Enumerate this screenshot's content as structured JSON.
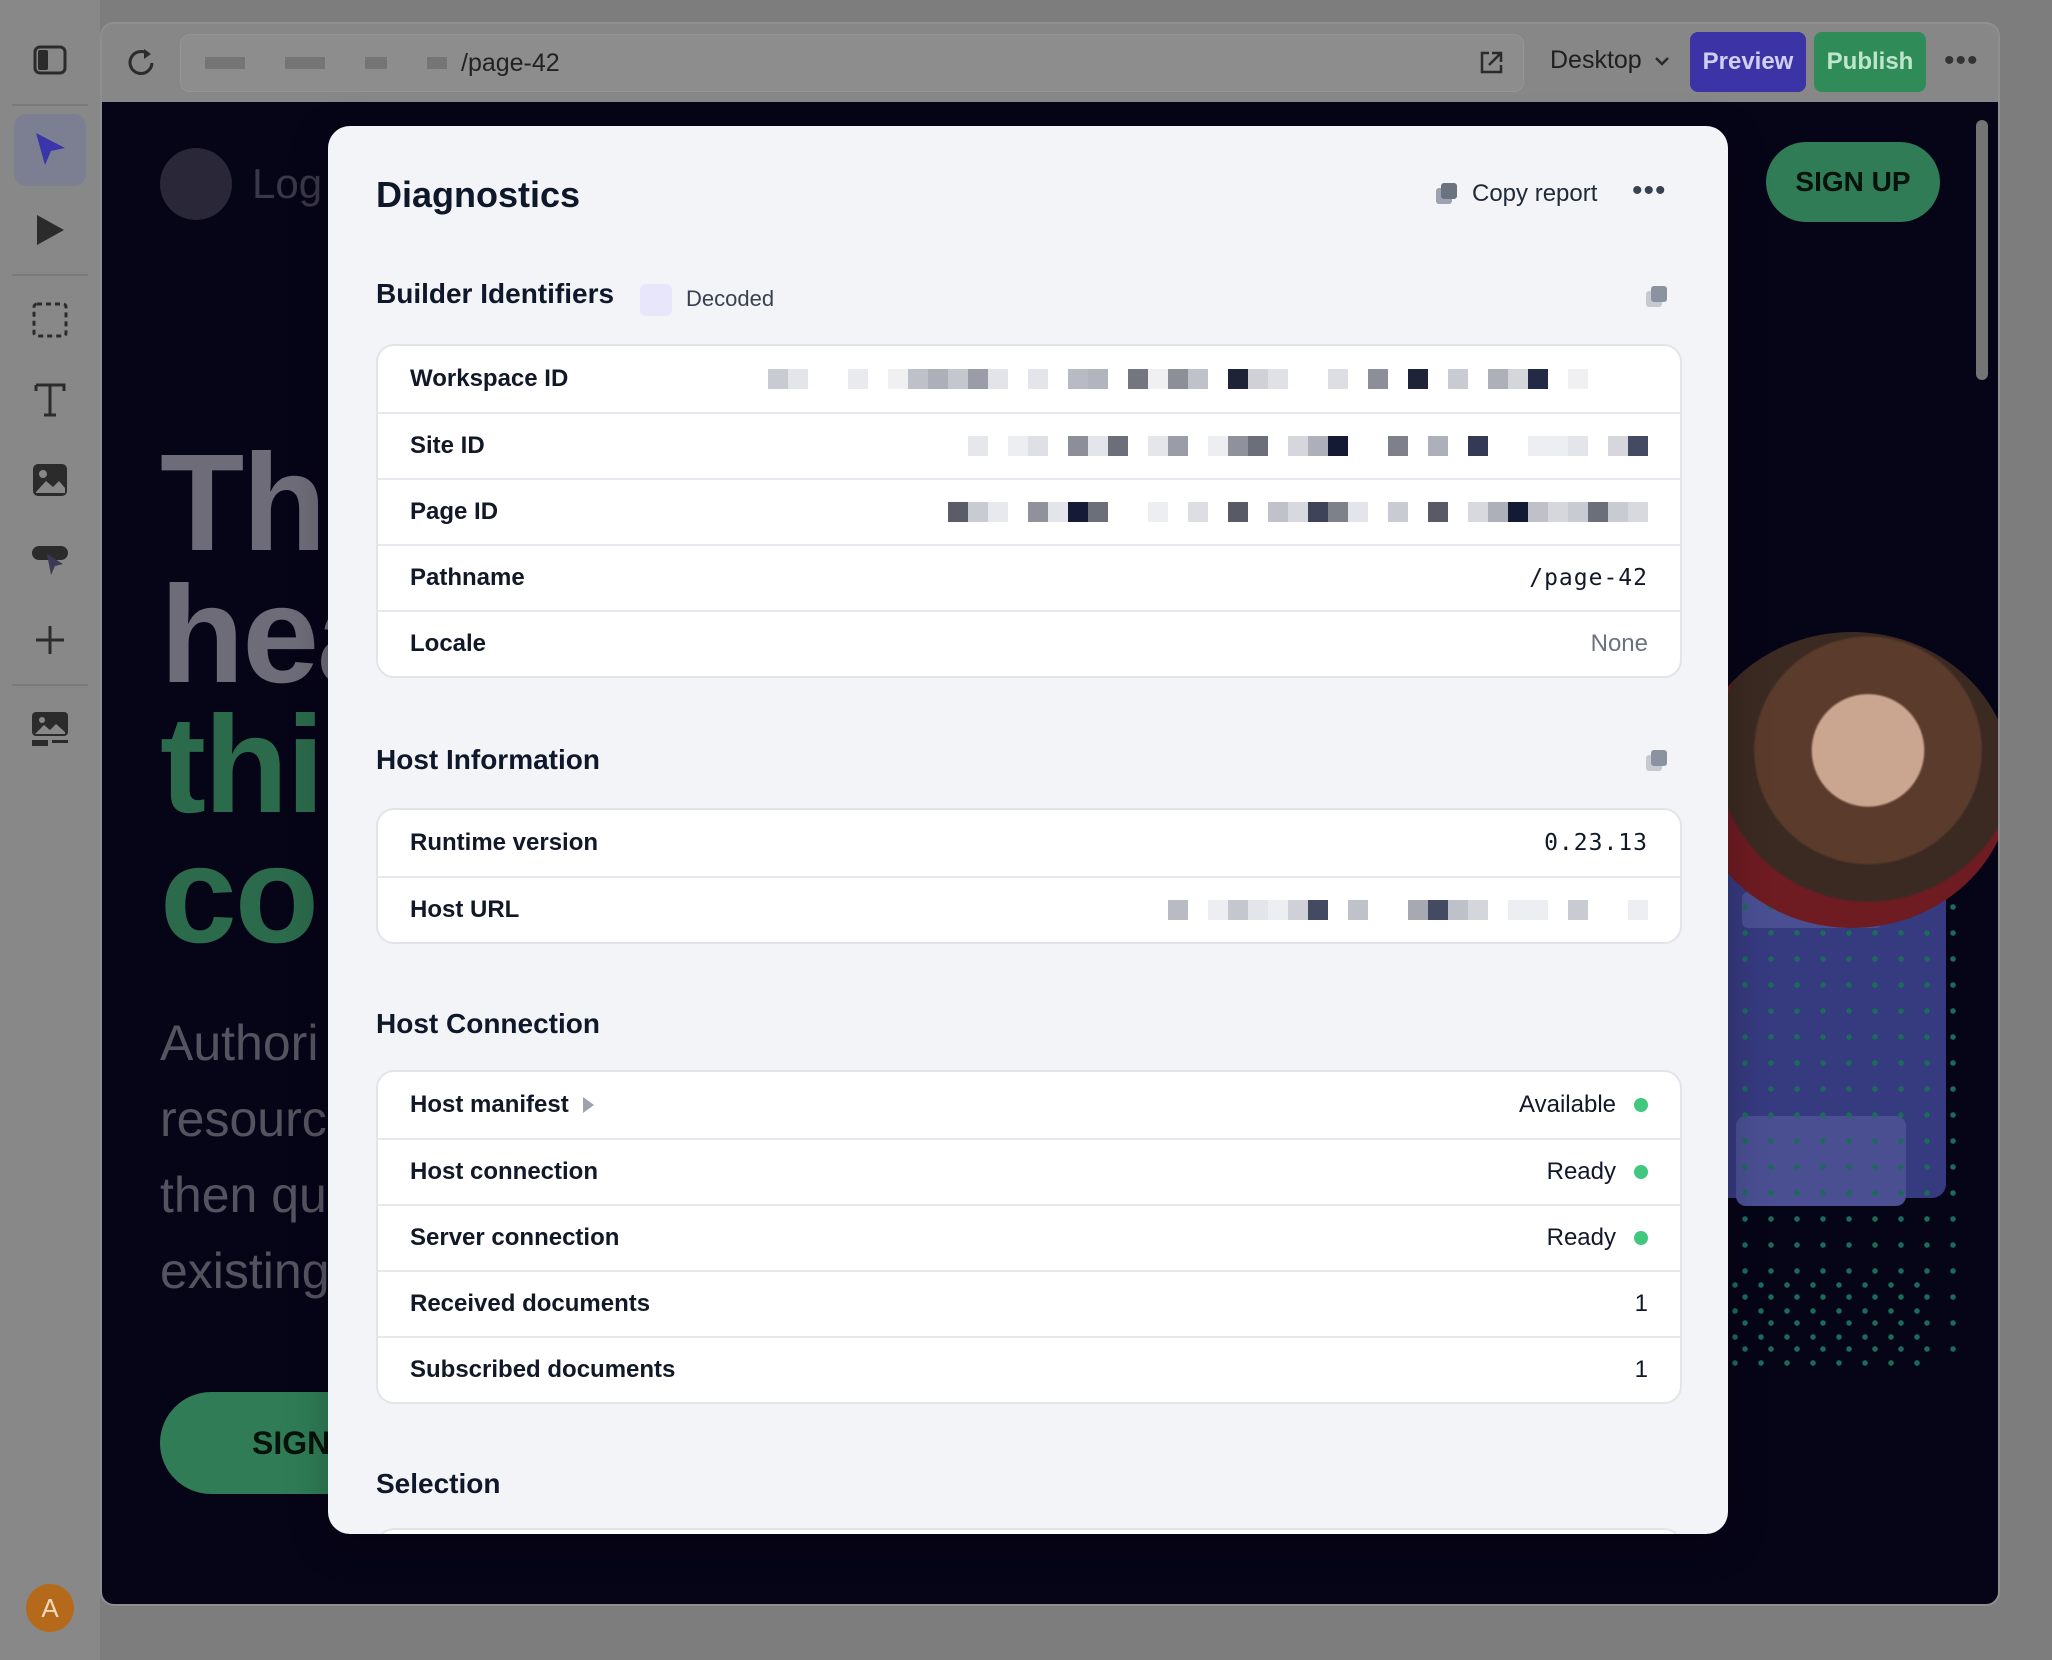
{
  "toolbar": {
    "url_path": "/page-42",
    "device": "Desktop",
    "preview_label": "Preview",
    "publish_label": "Publish",
    "more_label": "•••"
  },
  "rail": {
    "avatar_initial": "A"
  },
  "site": {
    "logo_text": "Log",
    "signup_top": "SIGN UP",
    "hero_lines": [
      "Thi",
      "hea",
      "thi",
      "co"
    ],
    "sub_lines": [
      "Authori",
      "resourc",
      "then qu",
      "existing"
    ],
    "signup_hero": "SIGN"
  },
  "modal": {
    "title": "Diagnostics",
    "copy_report": "Copy report",
    "more_label": "•••",
    "builder": {
      "title": "Builder Identifiers",
      "badge": "Decoded",
      "rows": [
        {
          "key": "Workspace ID",
          "value": "[redacted]"
        },
        {
          "key": "Site ID",
          "value": "[redacted]"
        },
        {
          "key": "Page ID",
          "value": "[redacted]"
        },
        {
          "key": "Pathname",
          "value": "/page-42"
        },
        {
          "key": "Locale",
          "value": "None"
        }
      ]
    },
    "host_info": {
      "title": "Host Information",
      "rows": [
        {
          "key": "Runtime version",
          "value": "0.23.13"
        },
        {
          "key": "Host URL",
          "value": "[redacted]"
        }
      ]
    },
    "host_connection": {
      "title": "Host Connection",
      "rows": [
        {
          "key": "Host manifest",
          "value": "Available"
        },
        {
          "key": "Host connection",
          "value": "Ready"
        },
        {
          "key": "Server connection",
          "value": "Ready"
        },
        {
          "key": "Received documents",
          "value": "1"
        },
        {
          "key": "Subscribed documents",
          "value": "1"
        }
      ]
    },
    "selection": {
      "title": "Selection"
    }
  },
  "colors": {
    "status_ok": "#41c77e",
    "preview": "#3b33a6",
    "publish": "#2f8b57",
    "brand_green": "#2f7c56"
  }
}
